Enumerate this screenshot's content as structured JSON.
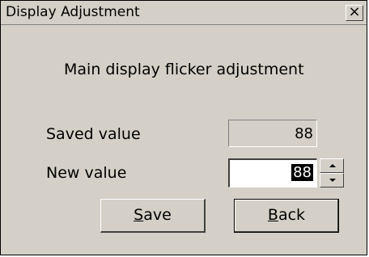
{
  "window": {
    "title": "Display Adjustment",
    "close_glyph": "×"
  },
  "main": {
    "heading": "Main display flicker adjustment",
    "saved_label": "Saved value",
    "saved_value": "88",
    "new_label": "New value",
    "new_value": "88"
  },
  "buttons": {
    "save_mnemonic": "S",
    "save_rest": "ave",
    "back_mnemonic": "B",
    "back_rest": "ack"
  },
  "icons": {
    "close": "close-icon",
    "spin_up": "chevron-up-icon",
    "spin_down": "chevron-down-icon"
  }
}
